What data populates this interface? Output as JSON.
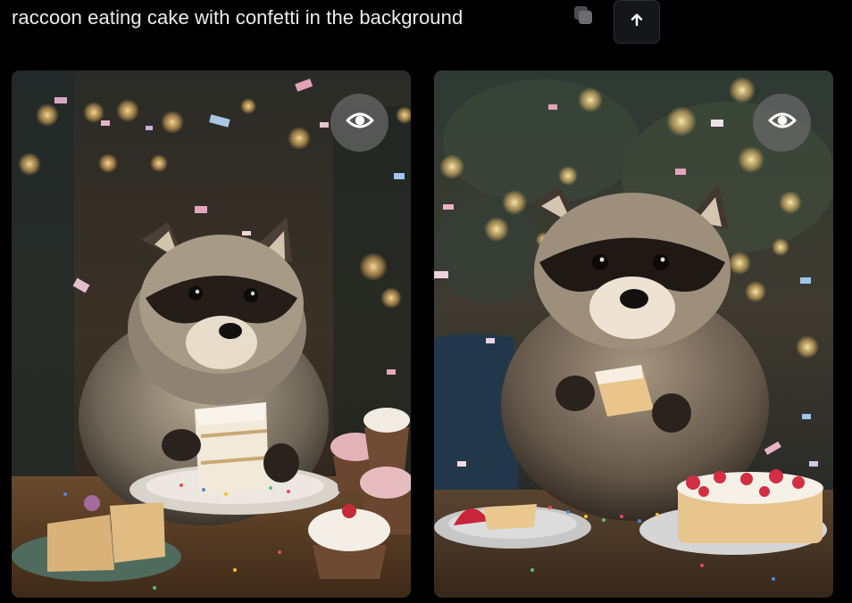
{
  "prompt": {
    "text": "raccoon eating cake with confetti in the background"
  },
  "icons": {
    "copy": "copy-icon",
    "upload": "arrow-up-icon",
    "view": "eye-icon"
  },
  "results": [
    {
      "scene": "raccoon-holding-layer-cake-slice",
      "view_icon": "eye-icon"
    },
    {
      "scene": "raccoon-holding-cake-bite-strawberry-cake",
      "view_icon": "eye-icon"
    }
  ],
  "colors": {
    "background": "#000000",
    "prompt_text": "#ededed",
    "button_bg": "#15161a",
    "eye_button_bg": "#6b6b6b"
  }
}
